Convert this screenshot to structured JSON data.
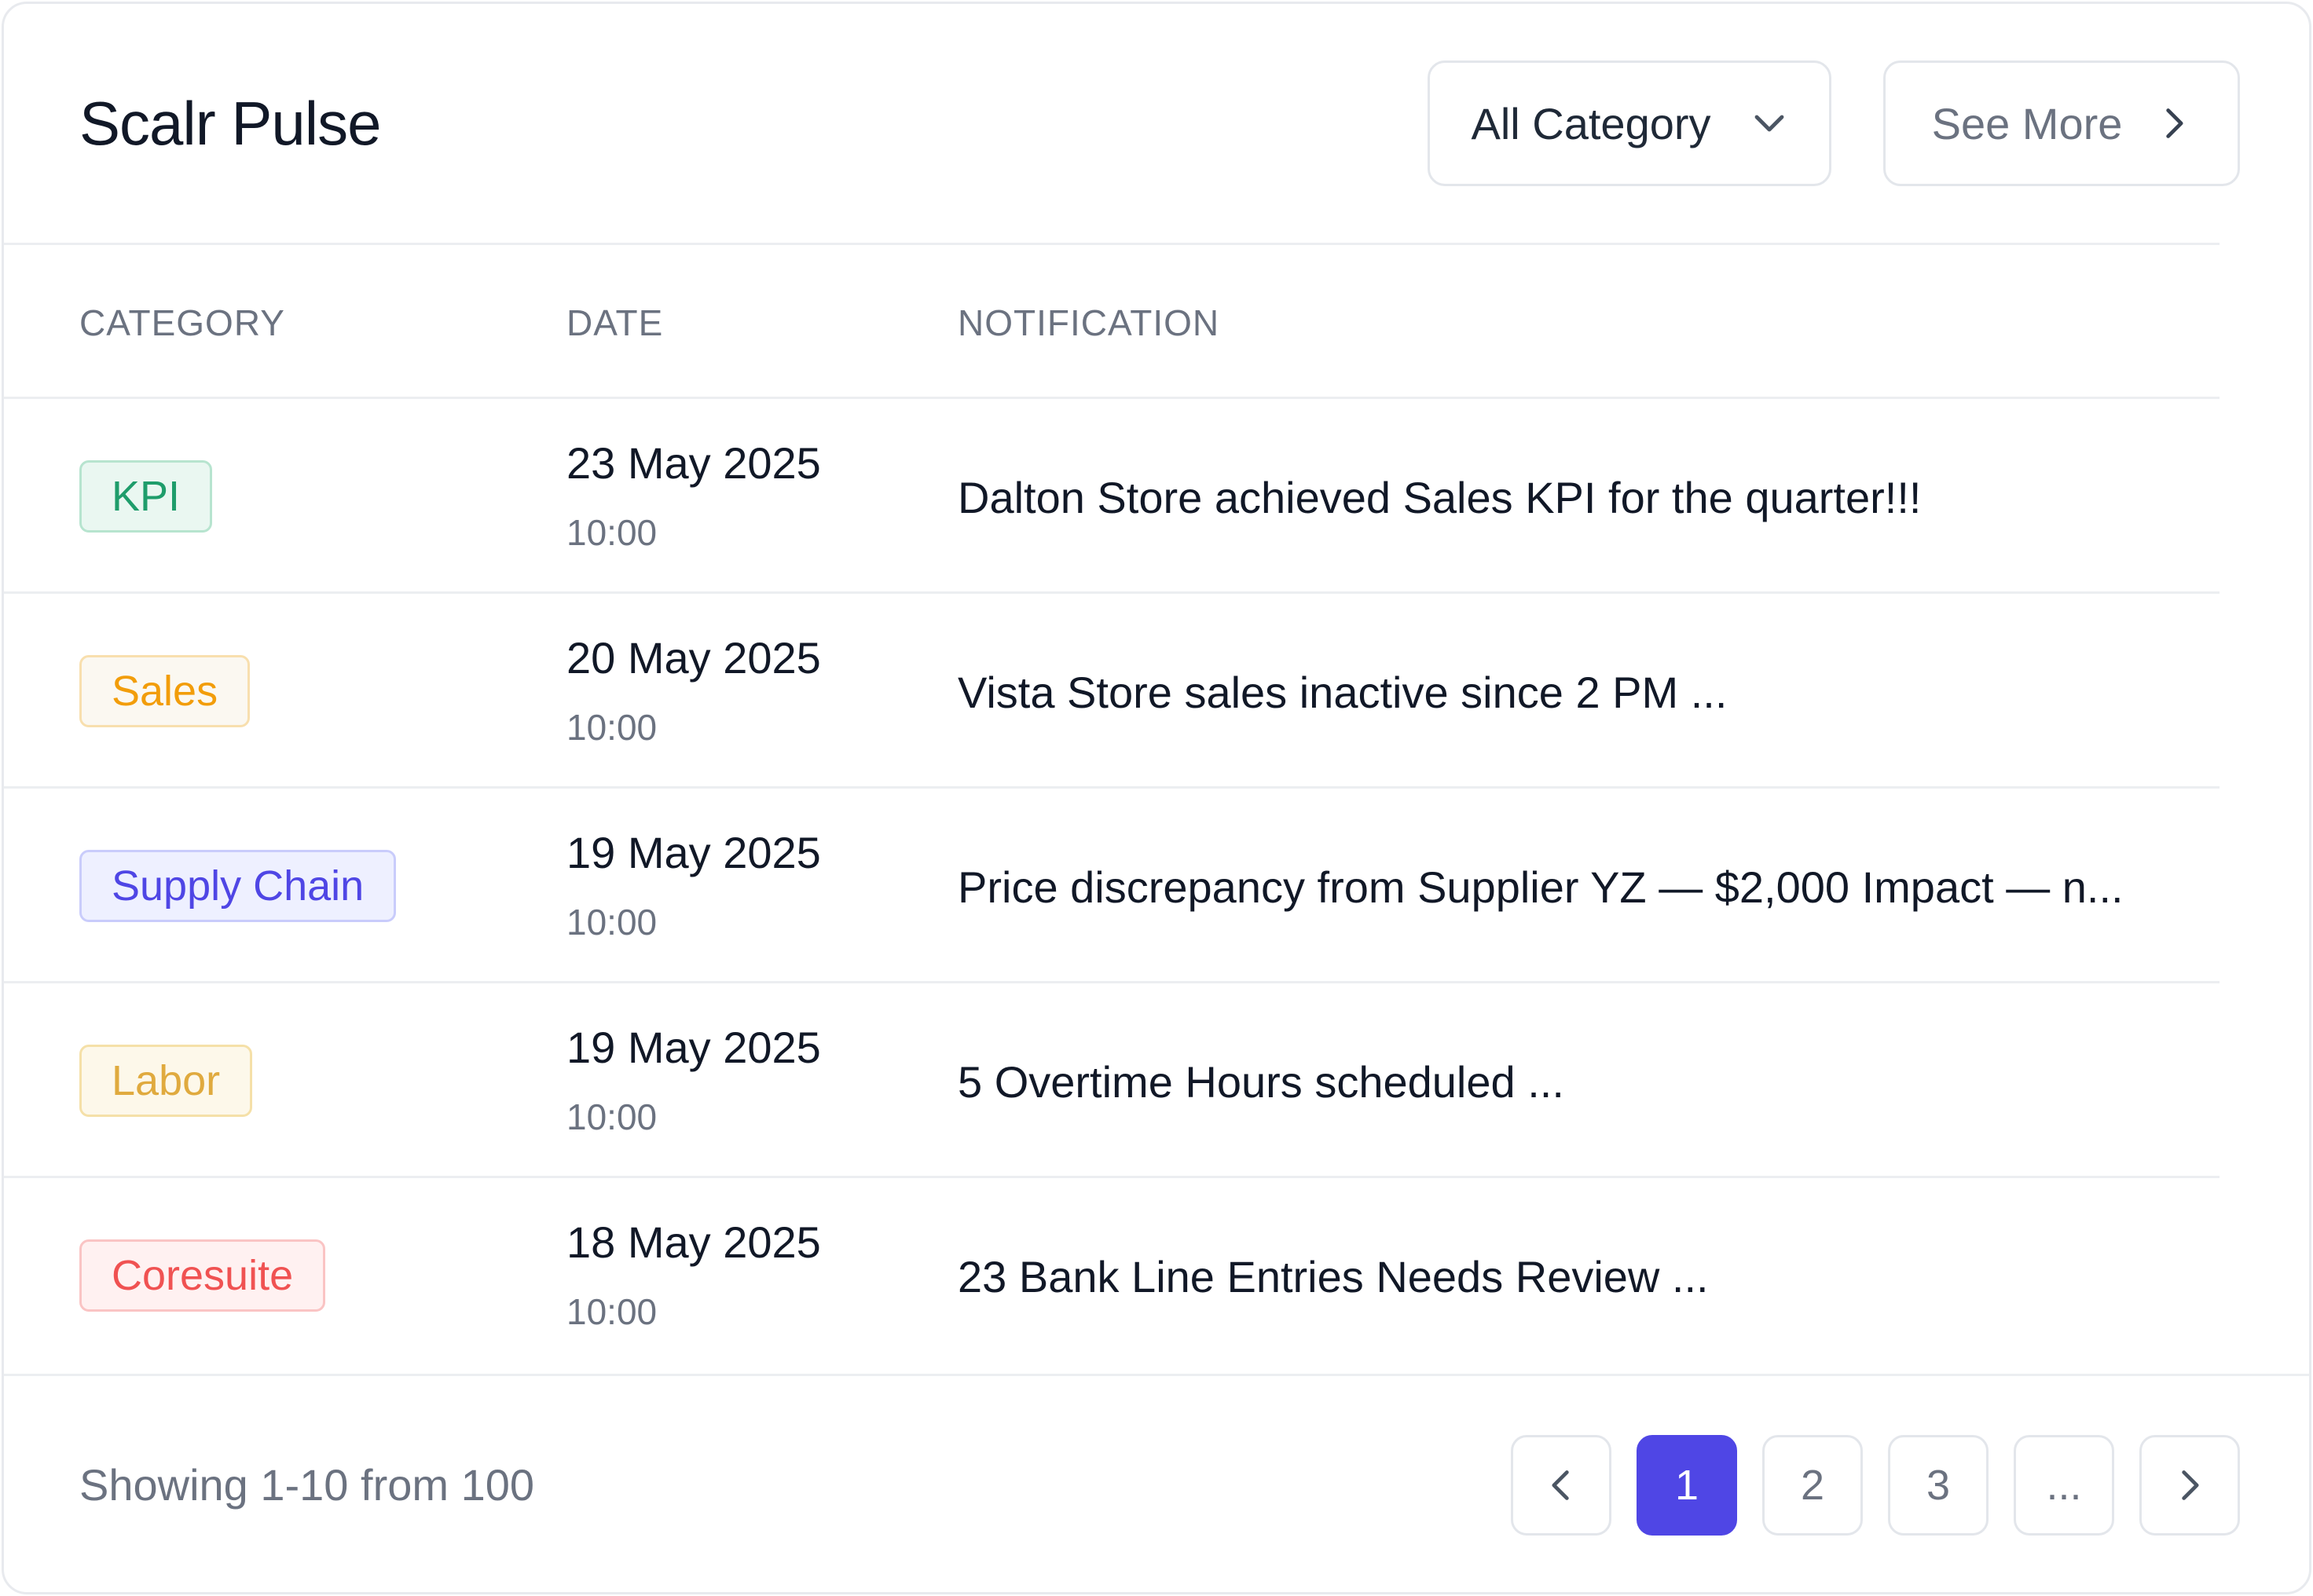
{
  "header": {
    "title": "Scalr Pulse",
    "category_filter": "All Category",
    "see_more": "See More"
  },
  "table": {
    "columns": [
      "CATEGORY",
      "DATE",
      "NOTIFICATION"
    ],
    "rows": [
      {
        "category": "KPI",
        "date": "23 May 2025",
        "time": "10:00",
        "notification": "Dalton Store achieved Sales KPI for the quarter!!!"
      },
      {
        "category": "Sales",
        "date": "20 May 2025",
        "time": "10:00",
        "notification": "Vista Store sales inactive since 2 PM ..."
      },
      {
        "category": "Supply Chain",
        "date": "19 May 2025",
        "time": "10:00",
        "notification": "Price discrepancy from Supplier YZ — $2,000 Impact — n..."
      },
      {
        "category": "Labor",
        "date": "19 May 2025",
        "time": "10:00",
        "notification": "5 Overtime Hours scheduled ..."
      },
      {
        "category": "Coresuite",
        "date": "18 May 2025",
        "time": "10:00",
        "notification": "23 Bank Line Entries Needs Review ..."
      }
    ]
  },
  "badge_colors": {
    "KPI": {
      "text": "#1f9d6b",
      "bg": "#eaf7f1",
      "border": "#b7e4cf"
    },
    "Sales": {
      "text": "#f29d0a",
      "bg": "#fbf8f1",
      "border": "#f8dfae"
    },
    "Supply Chain": {
      "text": "#4f46e5",
      "bg": "#eef0ff",
      "border": "#c9ccfb"
    },
    "Labor": {
      "text": "#e0aa3e",
      "bg": "#fdf8ea",
      "border": "#f5e0a8"
    },
    "Coresuite": {
      "text": "#f05252",
      "bg": "#fff1f1",
      "border": "#fac4c4"
    }
  },
  "footer": {
    "showing": "Showing 1-10 from 100",
    "pages": [
      "1",
      "2",
      "3",
      "..."
    ],
    "active_page": "1"
  },
  "icons": {
    "category_filter": "chevron-down-icon",
    "see_more": "chevron-right-icon",
    "prev": "chevron-left-icon",
    "next": "chevron-right-icon"
  },
  "colors": {
    "accent": "#4f46e5",
    "border": "#e3e6eb",
    "muted_text": "#6b7280",
    "primary_text": "#111827"
  }
}
